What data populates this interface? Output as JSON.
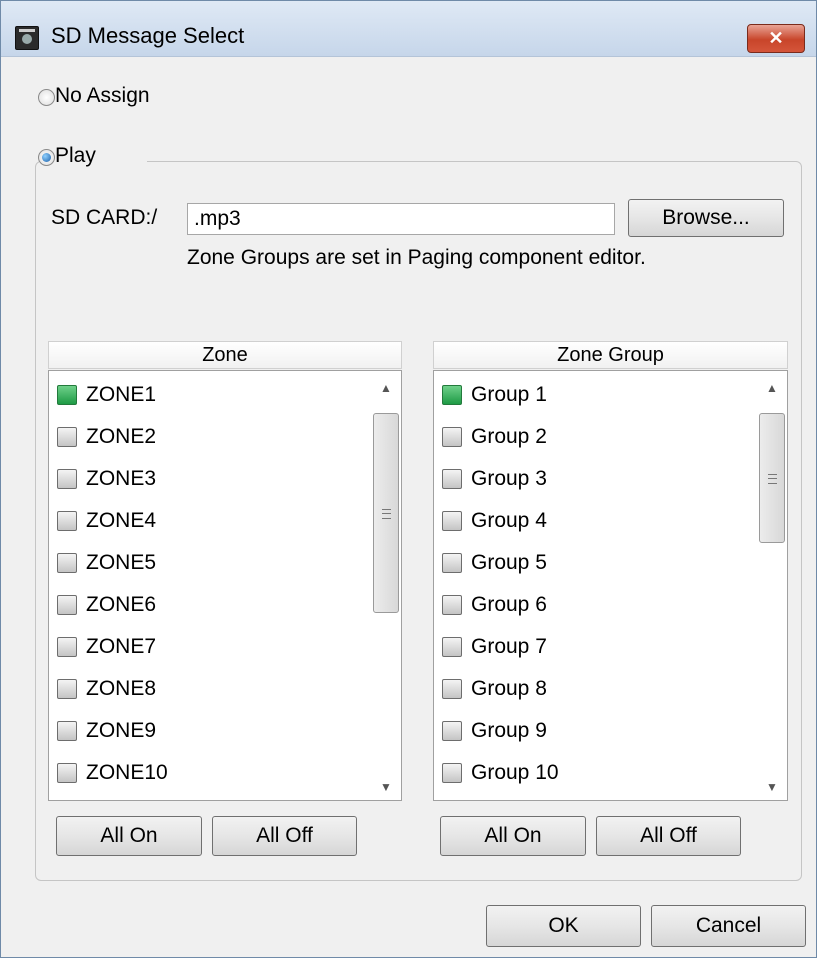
{
  "window": {
    "title": "SD Message Select",
    "close_symbol": "✕"
  },
  "options": {
    "no_assign_label": "No Assign",
    "play_label": "Play"
  },
  "play": {
    "path_label": "SD CARD:/",
    "file_value": ".mp3",
    "browse_label": "Browse...",
    "hint": "Zone Groups are set in Paging component editor."
  },
  "zone_list": {
    "header": "Zone",
    "items": [
      {
        "label": "ZONE1",
        "checked": true
      },
      {
        "label": "ZONE2",
        "checked": false
      },
      {
        "label": "ZONE3",
        "checked": false
      },
      {
        "label": "ZONE4",
        "checked": false
      },
      {
        "label": "ZONE5",
        "checked": false
      },
      {
        "label": "ZONE6",
        "checked": false
      },
      {
        "label": "ZONE7",
        "checked": false
      },
      {
        "label": "ZONE8",
        "checked": false
      },
      {
        "label": "ZONE9",
        "checked": false
      },
      {
        "label": "ZONE10",
        "checked": false
      }
    ],
    "all_on_label": "All On",
    "all_off_label": "All Off"
  },
  "group_list": {
    "header": "Zone Group",
    "items": [
      {
        "label": "Group 1",
        "checked": true
      },
      {
        "label": "Group 2",
        "checked": false
      },
      {
        "label": "Group 3",
        "checked": false
      },
      {
        "label": "Group 4",
        "checked": false
      },
      {
        "label": "Group 5",
        "checked": false
      },
      {
        "label": "Group 6",
        "checked": false
      },
      {
        "label": "Group 7",
        "checked": false
      },
      {
        "label": "Group 8",
        "checked": false
      },
      {
        "label": "Group 9",
        "checked": false
      },
      {
        "label": "Group 10",
        "checked": false
      }
    ],
    "all_on_label": "All On",
    "all_off_label": "All Off"
  },
  "footer": {
    "ok_label": "OK",
    "cancel_label": "Cancel"
  },
  "colors": {
    "checked_fill": "#2a9d4a",
    "close_button": "#c8452a"
  }
}
